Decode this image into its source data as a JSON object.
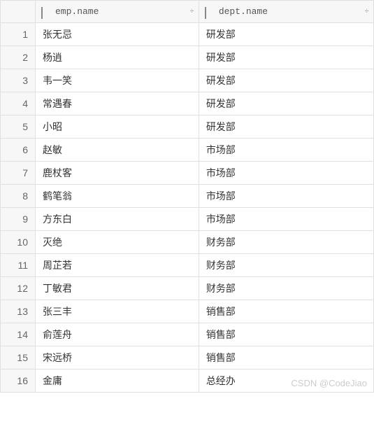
{
  "columns": [
    {
      "label": "emp.name"
    },
    {
      "label": "dept.name"
    }
  ],
  "sortGlyph": "÷",
  "rows": [
    {
      "n": "1",
      "emp": "张无忌",
      "dept": "研发部"
    },
    {
      "n": "2",
      "emp": "杨逍",
      "dept": "研发部"
    },
    {
      "n": "3",
      "emp": "韦一笑",
      "dept": "研发部"
    },
    {
      "n": "4",
      "emp": "常遇春",
      "dept": "研发部"
    },
    {
      "n": "5",
      "emp": "小昭",
      "dept": "研发部"
    },
    {
      "n": "6",
      "emp": "赵敏",
      "dept": "市场部"
    },
    {
      "n": "7",
      "emp": "鹿杖客",
      "dept": "市场部"
    },
    {
      "n": "8",
      "emp": "鹤笔翁",
      "dept": "市场部"
    },
    {
      "n": "9",
      "emp": "方东白",
      "dept": "市场部"
    },
    {
      "n": "10",
      "emp": "灭绝",
      "dept": "财务部"
    },
    {
      "n": "11",
      "emp": "周芷若",
      "dept": "财务部"
    },
    {
      "n": "12",
      "emp": "丁敏君",
      "dept": "财务部"
    },
    {
      "n": "13",
      "emp": "张三丰",
      "dept": "销售部"
    },
    {
      "n": "14",
      "emp": "俞莲舟",
      "dept": "销售部"
    },
    {
      "n": "15",
      "emp": "宋远桥",
      "dept": "销售部"
    },
    {
      "n": "16",
      "emp": "金庸",
      "dept": "总经办"
    }
  ],
  "watermark": "CSDN @CodeJiao"
}
